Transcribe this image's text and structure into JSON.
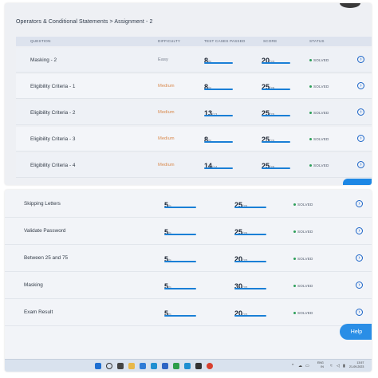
{
  "breadcrumb": "Operators & Conditional Statements > Assignment - 2",
  "columns": {
    "question": "QUESTION",
    "difficulty": "DIFFICULTY",
    "tests": "TEST CASES PASSED",
    "score": "SCORE",
    "status": "STATUS"
  },
  "top_rows": [
    {
      "name": "Masking - 2",
      "difficulty": "Easy",
      "difficulty_level": "easy",
      "tests_big": "8",
      "tests_small": "/8",
      "score_big": "20",
      "score_small": "/20",
      "status": "SOLVED"
    },
    {
      "name": "Eligibility Criteria - 1",
      "difficulty": "Medium",
      "difficulty_level": "medium",
      "tests_big": "8",
      "tests_small": "/8",
      "score_big": "25",
      "score_small": "/25",
      "status": "SOLVED"
    },
    {
      "name": "Eligibility Criteria - 2",
      "difficulty": "Medium",
      "difficulty_level": "medium",
      "tests_big": "13",
      "tests_small": "/13",
      "score_big": "25",
      "score_small": "/25",
      "status": "SOLVED"
    },
    {
      "name": "Eligibility Criteria - 3",
      "difficulty": "Medium",
      "difficulty_level": "medium",
      "tests_big": "8",
      "tests_small": "/8",
      "score_big": "25",
      "score_small": "/25",
      "status": "SOLVED"
    },
    {
      "name": "Eligibility Criteria - 4",
      "difficulty": "Medium",
      "difficulty_level": "medium",
      "tests_big": "14",
      "tests_small": "/14",
      "score_big": "25",
      "score_small": "/25",
      "status": "SOLVED"
    }
  ],
  "bottom_rows": [
    {
      "name": "Skipping Letters",
      "tests_big": "5",
      "tests_small": "/5",
      "score_big": "25",
      "score_small": "/25",
      "status": "SOLVED"
    },
    {
      "name": "Validate Password",
      "tests_big": "5",
      "tests_small": "/5",
      "score_big": "25",
      "score_small": "/25",
      "status": "SOLVED"
    },
    {
      "name": "Between 25 and 75",
      "tests_big": "5",
      "tests_small": "/5",
      "score_big": "20",
      "score_small": "/20",
      "status": "SOLVED"
    },
    {
      "name": "Masking",
      "tests_big": "5",
      "tests_small": "/5",
      "score_big": "30",
      "score_small": "/30",
      "status": "SOLVED"
    },
    {
      "name": "Exam Result",
      "tests_big": "5",
      "tests_small": "/5",
      "score_big": "20",
      "score_small": "/20",
      "status": "SOLVED"
    }
  ],
  "help_label": "Help",
  "taskbar": {
    "lang_top": "ENG",
    "lang_bottom": "IN",
    "time": "13:57",
    "date": "21-09-2023"
  },
  "colors": {
    "accent": "#1a7fd6",
    "solved_dot": "#2e9f5a",
    "medium": "#d98a4e",
    "easy": "#7a8290"
  },
  "icons": {
    "open": "circle-arrow-right-icon",
    "status": "green-dot-icon"
  }
}
